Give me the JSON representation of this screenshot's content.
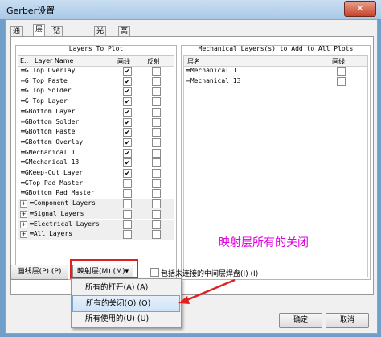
{
  "window": {
    "title": "Gerber设置",
    "close": "✕"
  },
  "tabs": [
    "通用",
    "层",
    "钻孔图层",
    "光圈",
    "高级"
  ],
  "left_panel": {
    "title": "Layers To Plot",
    "headers": {
      "ext": "E..",
      "name": "Layer Name",
      "plot": "画线",
      "mirror": "反射"
    },
    "layers": [
      {
        "name": "G Top Overlay",
        "plot": true
      },
      {
        "name": "G Top Paste",
        "plot": true
      },
      {
        "name": "G Top Solder",
        "plot": true
      },
      {
        "name": "G Top Layer",
        "plot": true
      },
      {
        "name": "GBottom Layer",
        "plot": true
      },
      {
        "name": "GBottom Solder",
        "plot": true
      },
      {
        "name": "GBottom Paste",
        "plot": true
      },
      {
        "name": "GBottom Overlay",
        "plot": true
      },
      {
        "name": "GMechanical 1",
        "plot": true
      },
      {
        "name": "GMechanical 13",
        "plot": true
      },
      {
        "name": "GKeep-Out Layer",
        "plot": true
      },
      {
        "name": "GTop Pad Master",
        "plot": false
      },
      {
        "name": "GBottom Pad Master",
        "plot": false
      }
    ],
    "groups": [
      "Component Layers",
      "Signal Layers",
      "Electrical Layers",
      "All Layers"
    ]
  },
  "right_panel": {
    "title": "Mechanical Layers(s) to Add to All Plots",
    "headers": {
      "name": "层名",
      "plot": "画线"
    },
    "layers": [
      "Mechanical 1",
      "Mechanical 13"
    ]
  },
  "bottom": {
    "plot_layers_btn": "画线层(P) (P)",
    "mirror_layers_btn": "映射层(M) (M)▾",
    "include_unconnected": "包括未连接的中间层焊盘(I) (I)"
  },
  "menu": {
    "items": [
      "所有的打开(A) (A)",
      "所有的关闭(O) (O)",
      "所有使用的(U) (U)"
    ]
  },
  "annotation": "映射层所有的关闭",
  "footer": {
    "ok": "确定",
    "cancel": "取消"
  }
}
